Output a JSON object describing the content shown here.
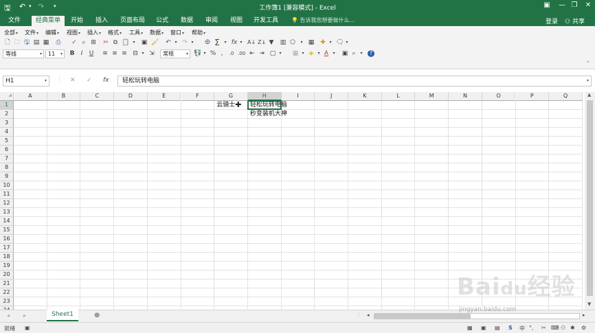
{
  "window": {
    "title": "工作簿1 [兼容模式] - Excel",
    "login": "登录",
    "share": "共享"
  },
  "tabs": [
    "文件",
    "经典菜单",
    "开始",
    "插入",
    "页面布局",
    "公式",
    "数据",
    "审阅",
    "视图",
    "开发工具"
  ],
  "tell_me": "告诉我您想要做什么...",
  "classic_menu": [
    "全部",
    "文件",
    "编辑",
    "视图",
    "插入",
    "格式",
    "工具",
    "数据",
    "窗口",
    "帮助"
  ],
  "font": {
    "name": "等线",
    "size": "11",
    "number_format": "常规"
  },
  "formula_bar": {
    "name_box": "H1",
    "fx": "fx",
    "value": "轻松玩转电脑"
  },
  "grid": {
    "columns": [
      "A",
      "B",
      "C",
      "D",
      "E",
      "F",
      "G",
      "H",
      "I",
      "J",
      "K",
      "L",
      "M",
      "N",
      "O",
      "P",
      "Q"
    ],
    "rows": [
      "1",
      "2",
      "3",
      "4",
      "5",
      "6",
      "7",
      "8",
      "9",
      "10",
      "11",
      "12",
      "13",
      "14",
      "15",
      "16",
      "17",
      "18",
      "19",
      "20",
      "21",
      "22",
      "23",
      "24"
    ],
    "selected_cell": "H1",
    "cells": {
      "G1": "云骑士",
      "H1": "轻松玩转电脑",
      "H2": "秒变装机大神"
    }
  },
  "sheets": [
    "Sheet1"
  ],
  "status": {
    "mode": "就绪"
  },
  "watermark": {
    "brand": "Baidu经验",
    "url": "jingyan.baidu.com"
  },
  "colors": {
    "accent": "#217346"
  }
}
